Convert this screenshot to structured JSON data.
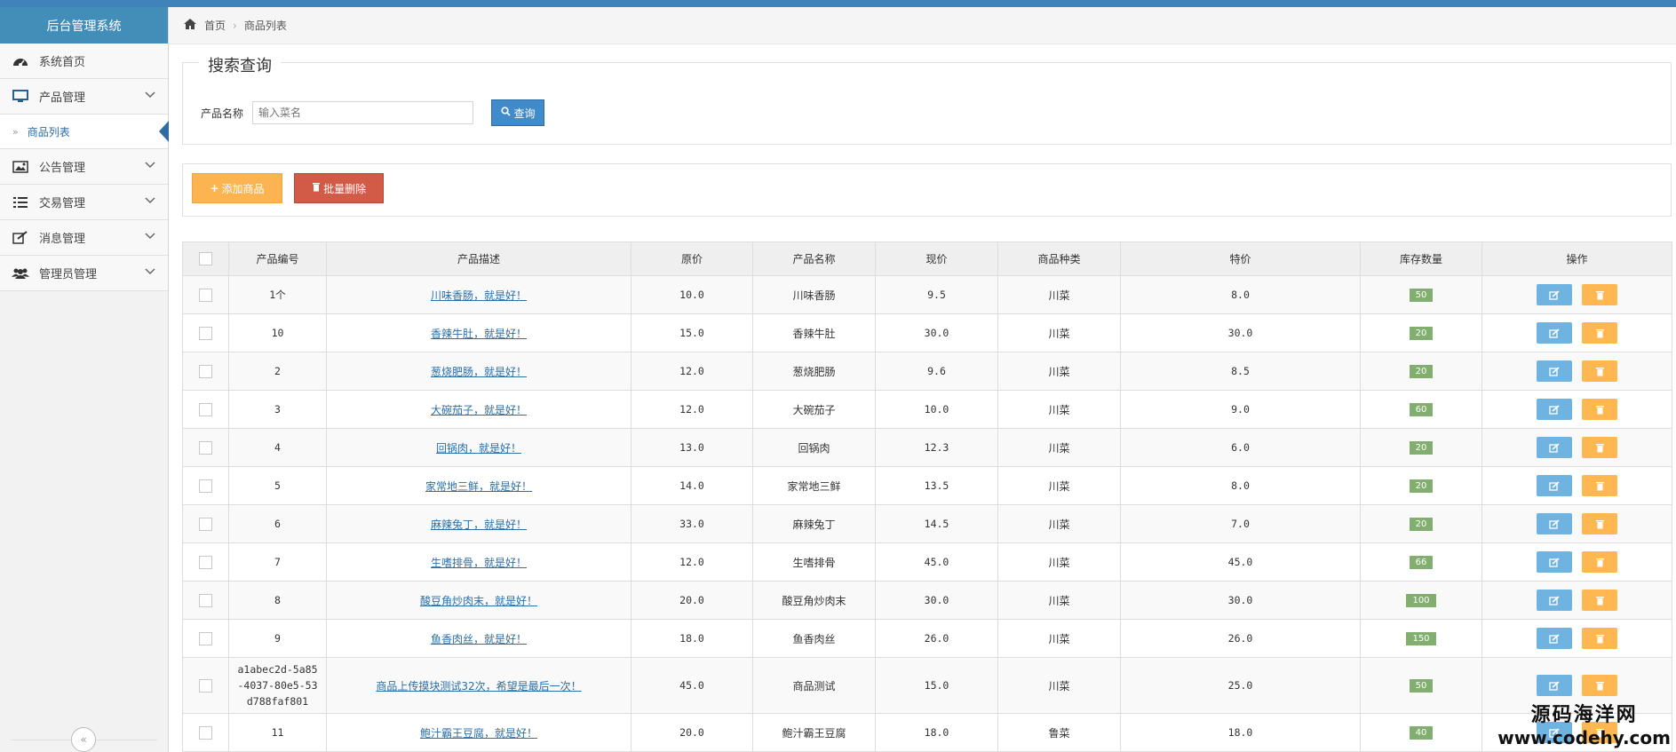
{
  "app_title": "后台管理系统",
  "sidebar": {
    "items": [
      {
        "label": "系统首页",
        "icon": "dashboard-icon"
      },
      {
        "label": "产品管理",
        "icon": "desktop-icon"
      },
      {
        "label": "商品列表",
        "icon": "double-chevron-icon"
      },
      {
        "label": "公告管理",
        "icon": "picture-icon"
      },
      {
        "label": "交易管理",
        "icon": "list-icon"
      },
      {
        "label": "消息管理",
        "icon": "edit-icon"
      },
      {
        "label": "管理员管理",
        "icon": "users-icon"
      }
    ]
  },
  "breadcrumb": {
    "home": "首页",
    "current": "商品列表"
  },
  "search": {
    "legend": "搜索查询",
    "label": "产品名称",
    "placeholder": "输入菜名",
    "button": "查询"
  },
  "toolbar": {
    "add_label": "添加商品",
    "batch_delete_label": "批量删除"
  },
  "table": {
    "headers": [
      "产品编号",
      "产品描述",
      "原价",
      "产品名称",
      "现价",
      "商品种类",
      "特价",
      "库存数量",
      "操作"
    ],
    "rows": [
      {
        "id": "1个",
        "desc": "川味香肠，就是好！",
        "orig": "10.0",
        "name": "川味香肠",
        "now": "9.5",
        "kind": "川菜",
        "special": "8.0",
        "stock": "50"
      },
      {
        "id": "10",
        "desc": "香辣牛肚，就是好！",
        "orig": "15.0",
        "name": "香辣牛肚",
        "now": "30.0",
        "kind": "川菜",
        "special": "30.0",
        "stock": "20"
      },
      {
        "id": "2",
        "desc": "葱烧肥肠，就是好！",
        "orig": "12.0",
        "name": "葱烧肥肠",
        "now": "9.6",
        "kind": "川菜",
        "special": "8.5",
        "stock": "20"
      },
      {
        "id": "3",
        "desc": "大碗茄子，就是好！",
        "orig": "12.0",
        "name": "大碗茄子",
        "now": "10.0",
        "kind": "川菜",
        "special": "9.0",
        "stock": "60"
      },
      {
        "id": "4",
        "desc": "回锅肉，就是好！",
        "orig": "13.0",
        "name": "回锅肉",
        "now": "12.3",
        "kind": "川菜",
        "special": "6.0",
        "stock": "20"
      },
      {
        "id": "5",
        "desc": "家常地三鲜，就是好！",
        "orig": "14.0",
        "name": "家常地三鲜",
        "now": "13.5",
        "kind": "川菜",
        "special": "8.0",
        "stock": "20"
      },
      {
        "id": "6",
        "desc": "麻辣兔丁，就是好！",
        "orig": "33.0",
        "name": "麻辣兔丁",
        "now": "14.5",
        "kind": "川菜",
        "special": "7.0",
        "stock": "20"
      },
      {
        "id": "7",
        "desc": "生嗜排骨，就是好！",
        "orig": "12.0",
        "name": "生嗜排骨",
        "now": "45.0",
        "kind": "川菜",
        "special": "45.0",
        "stock": "66"
      },
      {
        "id": "8",
        "desc": "酸豆角炒肉末，就是好！",
        "orig": "20.0",
        "name": "酸豆角炒肉末",
        "now": "30.0",
        "kind": "川菜",
        "special": "30.0",
        "stock": "100"
      },
      {
        "id": "9",
        "desc": "鱼香肉丝，就是好！",
        "orig": "18.0",
        "name": "鱼香肉丝",
        "now": "26.0",
        "kind": "川菜",
        "special": "26.0",
        "stock": "150"
      },
      {
        "id": "a1abec2d-5a85-4037-80e5-53d788faf801",
        "id_lines": [
          "a1abec2d-5a85",
          "-4037-80e5-53",
          "d788faf801"
        ],
        "desc": "商品上传摸块测试32次，希望是最后一次！",
        "orig": "45.0",
        "name": "商品测试",
        "now": "15.0",
        "kind": "川菜",
        "special": "25.0",
        "stock": "50"
      },
      {
        "id": "11",
        "desc": "鲍汁霸王豆腐，就是好！",
        "orig": "20.0",
        "name": "鲍汁霸王豆腐",
        "now": "18.0",
        "kind": "鲁菜",
        "special": "18.0",
        "stock": "40"
      }
    ]
  },
  "watermark": {
    "line1": "源码海洋网",
    "line2": "www.codehy.com"
  },
  "colors": {
    "brand": "#438eb9",
    "badge": "#82af6f",
    "edit": "#6fb3e0",
    "delete": "#ffb752",
    "add": "#fbb450",
    "danger": "#d15b47"
  }
}
